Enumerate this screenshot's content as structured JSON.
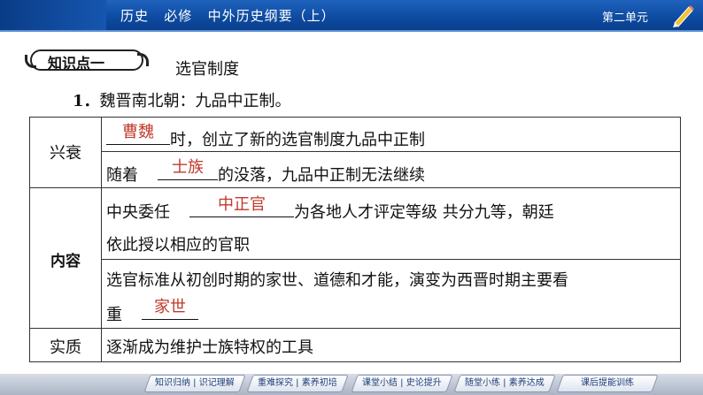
{
  "header": {
    "title": "历史   必修   中外历史纲要（上）",
    "unit": "第二单元",
    "icon": "pencil-icon"
  },
  "section": {
    "badge": "知识点一",
    "title": "选官制度",
    "intro_number": "1．",
    "intro_text": "魏晋南北朝：九品中正制。"
  },
  "table": {
    "rows": [
      {
        "label": "兴衰",
        "lines": [
          {
            "before": "",
            "answer": "曹魏",
            "after": "时，创立了新的选官制度九品中正制"
          },
          {
            "before": "随着",
            "answer": "士族",
            "after": "的没落，九品中正制无法继续"
          }
        ]
      },
      {
        "label": "内容",
        "lines": [
          {
            "before": "中央委任",
            "answer": "中正官",
            "after": "为各地人才评定等级  共分九等，朝廷"
          },
          {
            "text": "依此授以相应的官职"
          },
          {
            "text": "选官标准从初创时期的家世、道德和才能，演变为西晋时期主要看"
          },
          {
            "before": "重",
            "answer": "家世",
            "after": ""
          }
        ]
      },
      {
        "label": "实质",
        "lines": [
          {
            "text": "逐渐成为维护士族特权的工具"
          }
        ]
      }
    ]
  },
  "nav": {
    "buttons": [
      "知识归纳 | 识记理解",
      "重难探究 | 素养初培",
      "课堂小结 | 史论提升",
      "随堂小练 | 素养达成",
      "课后提能训练"
    ]
  },
  "colors": {
    "header_blue": "#0d4aa0",
    "answer_red": "#c0392b"
  }
}
